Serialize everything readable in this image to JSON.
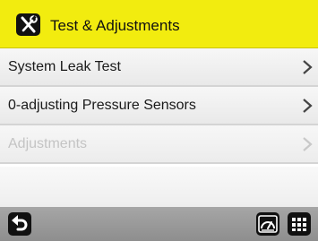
{
  "header": {
    "title": "Test & Adjustments",
    "icon": "tools-icon",
    "background": "#f2ec0f"
  },
  "menu": {
    "items": [
      {
        "label": "System Leak Test",
        "enabled": true
      },
      {
        "label": "0-adjusting Pressure Sensors",
        "enabled": true
      },
      {
        "label": "Adjustments",
        "enabled": false
      }
    ]
  },
  "footer": {
    "left_buttons": [
      "back-icon"
    ],
    "right_buttons": [
      "gauge-icon",
      "grid-menu-icon"
    ]
  }
}
